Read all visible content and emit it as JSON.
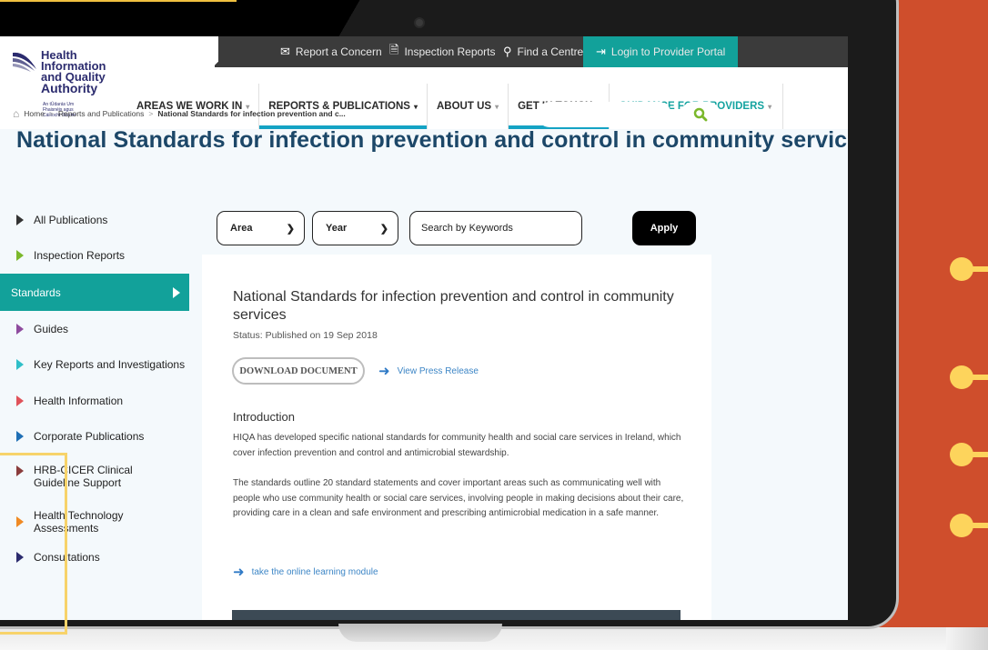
{
  "utility_nav": {
    "report_concern": "Report a Concern",
    "inspection_reports": "Inspection Reports",
    "find_centre": "Find a Centre",
    "login": "Login to Provider Portal"
  },
  "logo": {
    "name_lines": [
      "Health",
      "Information",
      "and Quality",
      "Authority"
    ],
    "irish": "An tÚdarás Um Fhaisnéis agus Cáilíocht Sláinte"
  },
  "main_nav": [
    {
      "label": "AREAS WE WORK IN",
      "caret": "▾"
    },
    {
      "label": "REPORTS & PUBLICATIONS",
      "caret": "▾"
    },
    {
      "label": "ABOUT US",
      "caret": "▾"
    },
    {
      "label": "GET IN TOUCH",
      "caret": "▾"
    },
    {
      "label": "GUIDANCE FOR PROVIDERS",
      "caret": "▾"
    }
  ],
  "breadcrumb": {
    "home": "Home",
    "section": "Reports and Publications",
    "current": "National Standards for infection prevention and c..."
  },
  "page_title": "National Standards for infection prevention and control in community services",
  "sidebar": [
    {
      "label": "All Publications",
      "color": "#333333"
    },
    {
      "label": "Inspection Reports",
      "color": "#7bb82b"
    },
    {
      "label": "Standards",
      "color": "#ffffff"
    },
    {
      "label": "Guides",
      "color": "#8e4b9e"
    },
    {
      "label": "Key Reports and Investigations",
      "color": "#2fbfc8"
    },
    {
      "label": "Health Information",
      "color": "#e0525a"
    },
    {
      "label": "Corporate Publications",
      "color": "#1f6fb5"
    },
    {
      "label": "HRB-CICER Clinical Guideline Support",
      "color": "#8a3c3c"
    },
    {
      "label": "Health Technology Assessments",
      "color": "#f08a24"
    },
    {
      "label": "Consultations",
      "color": "#2b2b6e"
    }
  ],
  "filters": {
    "area": "Area",
    "year": "Year",
    "search_placeholder": "Search by Keywords",
    "apply": "Apply"
  },
  "document": {
    "title": "National Standards for infection prevention and control in community services",
    "status": "Status: Published on 19 Sep 2018",
    "download": "DOWNLOAD DOCUMENT",
    "press_release": "View Press Release",
    "intro_heading": "Introduction",
    "paragraph1": "HIQA has developed specific national standards for community health and social care services in Ireland, which cover infection prevention and control and antimicrobial stewardship.",
    "paragraph2": "The standards outline 20 standard statements and cover important areas such as communicating well with people who use community health or social care services, involving people in making decisions about their care, providing care in a clean and safe environment and prescribing antimicrobial medication in a safe manner.",
    "learning_link": "take the online learning module"
  },
  "icons": {
    "report": "✉",
    "inspection": "🗎",
    "find": "⚲",
    "login": "⇥",
    "search": "🔍",
    "home": "⌂",
    "arrow": "➜"
  },
  "colors": {
    "teal": "#12a19a",
    "title_blue": "#1c4768",
    "orange_bg": "#cf4e2c",
    "accent_yellow": "#fdd45c"
  }
}
